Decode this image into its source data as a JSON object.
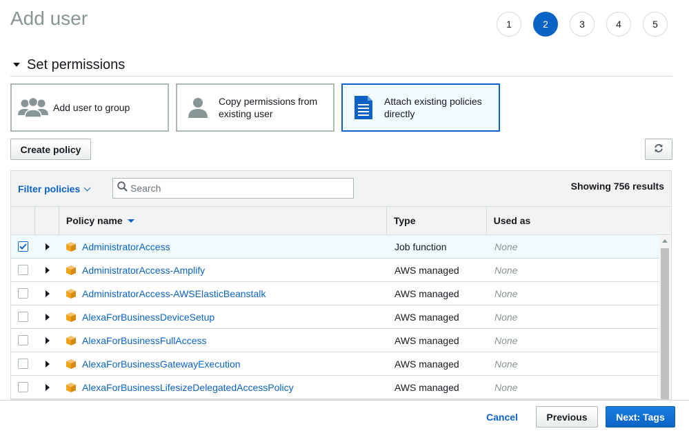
{
  "page": {
    "title": "Add user"
  },
  "steps": [
    "1",
    "2",
    "3",
    "4",
    "5"
  ],
  "active_step": "2",
  "section": {
    "title": "Set permissions"
  },
  "options": [
    {
      "label": "Add user to group",
      "icon": "users-group-icon",
      "selected": false
    },
    {
      "label": "Copy permissions from existing user",
      "icon": "user-icon",
      "selected": false
    },
    {
      "label": "Attach existing policies directly",
      "icon": "document-icon",
      "selected": true
    }
  ],
  "actions": {
    "create_policy": "Create policy",
    "refresh_icon": "refresh-icon"
  },
  "toolbar": {
    "filter_label": "Filter policies",
    "search_placeholder": "Search",
    "showing": "Showing 756 results"
  },
  "table": {
    "columns": [
      "Policy name",
      "Type",
      "Used as"
    ],
    "rows": [
      {
        "name": "AdministratorAccess",
        "type": "Job function",
        "used_as": "None",
        "checked": true
      },
      {
        "name": "AdministratorAccess-Amplify",
        "type": "AWS managed",
        "used_as": "None",
        "checked": false
      },
      {
        "name": "AdministratorAccess-AWSElasticBeanstalk",
        "type": "AWS managed",
        "used_as": "None",
        "checked": false
      },
      {
        "name": "AlexaForBusinessDeviceSetup",
        "type": "AWS managed",
        "used_as": "None",
        "checked": false
      },
      {
        "name": "AlexaForBusinessFullAccess",
        "type": "AWS managed",
        "used_as": "None",
        "checked": false
      },
      {
        "name": "AlexaForBusinessGatewayExecution",
        "type": "AWS managed",
        "used_as": "None",
        "checked": false
      },
      {
        "name": "AlexaForBusinessLifesizeDelegatedAccessPolicy",
        "type": "AWS managed",
        "used_as": "None",
        "checked": false
      }
    ]
  },
  "footer": {
    "cancel": "Cancel",
    "previous": "Previous",
    "next": "Next: Tags"
  },
  "colors": {
    "accent": "#0b63c5",
    "policy_icon": "#f0a316",
    "muted": "#879596"
  }
}
